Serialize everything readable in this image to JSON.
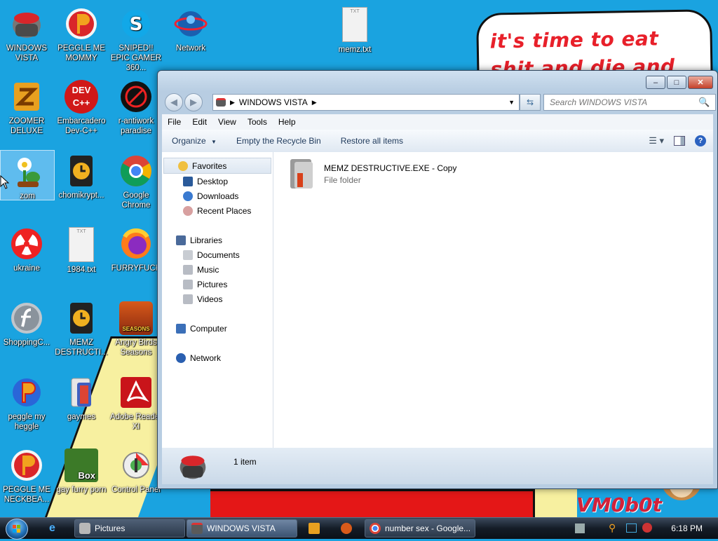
{
  "wallpaper": {
    "speech_text": "it's time to eat shit and die and chew",
    "watermark": "VM0b0t"
  },
  "desktop_icons": [
    {
      "label": "WINDOWS VISTA"
    },
    {
      "label": "PEGGLE ME MOMMY"
    },
    {
      "label": "SNIPED!! EPIC GAMER 360..."
    },
    {
      "label": "Network"
    },
    {
      "label": "memz.txt"
    },
    {
      "label": "ZOOMER DELUXE"
    },
    {
      "label": "Embarcadero Dev-C++"
    },
    {
      "label": "r-antiwork paradise"
    },
    {
      "label": "zom"
    },
    {
      "label": "chomikrypt..."
    },
    {
      "label": "Google Chrome"
    },
    {
      "label": "ukraine"
    },
    {
      "label": "1984.txt"
    },
    {
      "label": "FURRYFUCK"
    },
    {
      "label": "ShoppingC..."
    },
    {
      "label": "MEMZ DESTRUCTI..."
    },
    {
      "label": "Angry Birds Seasons"
    },
    {
      "label": "peggle my heggle"
    },
    {
      "label": "gaymes"
    },
    {
      "label": "Adobe Reader XI"
    },
    {
      "label": "PEGGLE ME NECKBEA..."
    },
    {
      "label": "gay furry porn"
    },
    {
      "label": "Control Panel"
    }
  ],
  "dev_icon_text": "DEV C++",
  "box_icon_text": "Box",
  "txt_icon_text": "TXT",
  "angry_icon_text": "SEASONS",
  "window": {
    "address_path": "WINDOWS VISTA",
    "search_placeholder": "Search WINDOWS VISTA",
    "menu": [
      "File",
      "Edit",
      "View",
      "Tools",
      "Help"
    ],
    "toolbar": {
      "organize": "Organize",
      "empty_bin": "Empty the Recycle Bin",
      "restore_all": "Restore all items"
    },
    "nav": {
      "favorites": "Favorites",
      "desktop": "Desktop",
      "downloads": "Downloads",
      "recent": "Recent Places",
      "libraries": "Libraries",
      "documents": "Documents",
      "music": "Music",
      "pictures": "Pictures",
      "videos": "Videos",
      "computer": "Computer",
      "network": "Network"
    },
    "file": {
      "name": "MEMZ DESTRUCTIVE.EXE - Copy",
      "type": "File folder"
    },
    "status_count": "1 item"
  },
  "taskbar": {
    "tasks": [
      {
        "label": "Pictures"
      },
      {
        "label": "WINDOWS VISTA"
      },
      {
        "label": "number sex - Google..."
      }
    ],
    "clock": "6:18 PM"
  },
  "colors": {
    "desktop_bg": "#1aa3e0",
    "speech_text": "#e8202a",
    "taskbar_bg": "#141c27"
  }
}
